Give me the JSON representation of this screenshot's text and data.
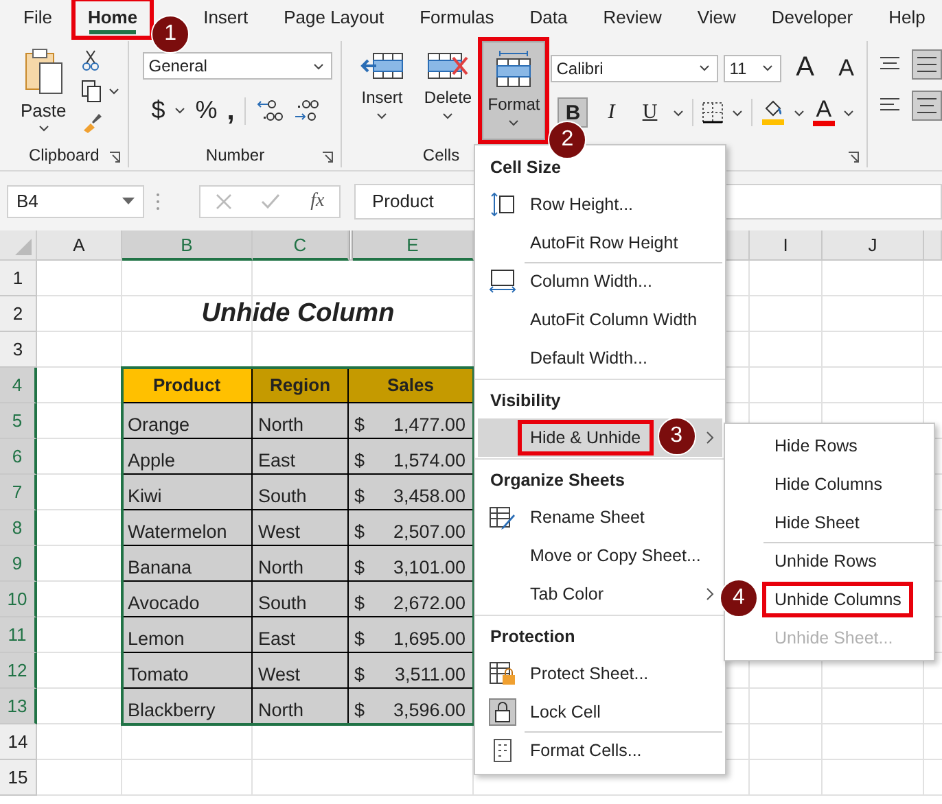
{
  "menu_tabs": [
    {
      "label": "File",
      "selected": false,
      "highlighted": false
    },
    {
      "label": "Home",
      "selected": true,
      "highlighted": true,
      "callout": "1"
    },
    {
      "label": "Insert",
      "selected": false,
      "highlighted": false
    },
    {
      "label": "Page Layout",
      "selected": false,
      "highlighted": false
    },
    {
      "label": "Formulas",
      "selected": false,
      "highlighted": false
    },
    {
      "label": "Data",
      "selected": false,
      "highlighted": false
    },
    {
      "label": "Review",
      "selected": false,
      "highlighted": false
    },
    {
      "label": "View",
      "selected": false,
      "highlighted": false
    },
    {
      "label": "Developer",
      "selected": false,
      "highlighted": false
    },
    {
      "label": "Help",
      "selected": false,
      "highlighted": false
    }
  ],
  "ribbon": {
    "clipboard": {
      "label": "Clipboard",
      "paste": "Paste"
    },
    "number": {
      "label": "Number",
      "format": "General",
      "symbols": [
        "$",
        "%",
        ","
      ]
    },
    "cells": {
      "label": "Cells",
      "buttons": [
        {
          "label": "Insert",
          "kind": "insert",
          "pressed": false,
          "highlighted": false
        },
        {
          "label": "Delete",
          "kind": "delete",
          "pressed": false,
          "highlighted": false
        },
        {
          "label": "Format",
          "kind": "format",
          "pressed": true,
          "highlighted": true,
          "callout": "2"
        }
      ]
    },
    "font": {
      "name": "Calibri",
      "size": "11",
      "grow": "A",
      "shrink": "A",
      "font_color": "A",
      "styles": [
        {
          "label": "B",
          "kind": "bold",
          "pressed": true
        },
        {
          "label": "I",
          "kind": "italic",
          "pressed": false
        },
        {
          "label": "U",
          "kind": "underline",
          "pressed": false
        }
      ]
    }
  },
  "formula_bar": {
    "name_box": "B4",
    "function_label": "fx",
    "value": "Product"
  },
  "sheet": {
    "columns": [
      {
        "label": "A",
        "selected": false
      },
      {
        "label": "B",
        "selected": true
      },
      {
        "label": "C",
        "selected": true
      },
      {
        "label": "E",
        "selected": true
      },
      {
        "label": "I",
        "selected": false
      },
      {
        "label": "J",
        "selected": false
      }
    ],
    "rows": [
      {
        "label": "1",
        "selected": false
      },
      {
        "label": "2",
        "selected": false
      },
      {
        "label": "3",
        "selected": false
      },
      {
        "label": "4",
        "selected": true
      },
      {
        "label": "5",
        "selected": true
      },
      {
        "label": "6",
        "selected": true
      },
      {
        "label": "7",
        "selected": true
      },
      {
        "label": "8",
        "selected": true
      },
      {
        "label": "9",
        "selected": true
      },
      {
        "label": "10",
        "selected": true
      },
      {
        "label": "11",
        "selected": true
      },
      {
        "label": "12",
        "selected": true
      },
      {
        "label": "13",
        "selected": true
      },
      {
        "label": "14",
        "selected": false
      },
      {
        "label": "15",
        "selected": false
      }
    ],
    "title": "Unhide Column",
    "table": {
      "columns": [
        {
          "label": "Product",
          "active": true
        },
        {
          "label": "Region",
          "active": false
        },
        {
          "label": "Sales",
          "active": false
        }
      ],
      "rows": [
        {
          "product": "Orange",
          "region": "North",
          "currency": "$",
          "sales": "1,477.00"
        },
        {
          "product": "Apple",
          "region": "East",
          "currency": "$",
          "sales": "1,574.00"
        },
        {
          "product": "Kiwi",
          "region": "South",
          "currency": "$",
          "sales": "3,458.00"
        },
        {
          "product": "Watermelon",
          "region": "West",
          "currency": "$",
          "sales": "2,507.00"
        },
        {
          "product": "Banana",
          "region": "North",
          "currency": "$",
          "sales": "3,101.00"
        },
        {
          "product": "Avocado",
          "region": "South",
          "currency": "$",
          "sales": "2,672.00"
        },
        {
          "product": "Lemon",
          "region": "East",
          "currency": "$",
          "sales": "1,695.00"
        },
        {
          "product": "Tomato",
          "region": "West",
          "currency": "$",
          "sales": "3,511.00"
        },
        {
          "product": "Blackberry",
          "region": "North",
          "currency": "$",
          "sales": "3,596.00"
        }
      ]
    }
  },
  "format_menu": {
    "sections": [
      {
        "title": "Cell Size",
        "items": [
          {
            "label": "Row Height...",
            "kind": "row-height",
            "separator_before": false,
            "submenu": false,
            "selected": false,
            "highlighted": false
          },
          {
            "label": "AutoFit Row Height",
            "kind": "plain",
            "separator_before": false,
            "submenu": false,
            "selected": false,
            "highlighted": false
          },
          {
            "label": "Column Width...",
            "kind": "column-width",
            "separator_before": true,
            "submenu": false,
            "selected": false,
            "highlighted": false
          },
          {
            "label": "AutoFit Column Width",
            "kind": "plain",
            "separator_before": false,
            "submenu": false,
            "selected": false,
            "highlighted": false
          },
          {
            "label": "Default Width...",
            "kind": "plain",
            "separator_before": false,
            "submenu": false,
            "selected": false,
            "highlighted": false
          }
        ]
      },
      {
        "title": "Visibility",
        "items": [
          {
            "label": "Hide & Unhide",
            "kind": "plain",
            "separator_before": false,
            "submenu": true,
            "selected": true,
            "highlighted": true,
            "callout": "3"
          }
        ]
      },
      {
        "title": "Organize Sheets",
        "items": [
          {
            "label": "Rename Sheet",
            "kind": "rename",
            "separator_before": false,
            "submenu": false,
            "selected": false,
            "highlighted": false
          },
          {
            "label": "Move or Copy Sheet...",
            "kind": "plain",
            "separator_before": false,
            "submenu": false,
            "selected": false,
            "highlighted": false
          },
          {
            "label": "Tab Color",
            "kind": "plain",
            "separator_before": false,
            "submenu": true,
            "selected": false,
            "highlighted": false
          }
        ]
      },
      {
        "title": "Protection",
        "items": [
          {
            "label": "Protect Sheet...",
            "kind": "protect",
            "separator_before": false,
            "submenu": false,
            "selected": false,
            "highlighted": false
          },
          {
            "label": "Lock Cell",
            "kind": "lock",
            "separator_before": false,
            "submenu": false,
            "selected": false,
            "highlighted": false
          },
          {
            "label": "Format Cells...",
            "kind": "format-cells",
            "separator_before": true,
            "submenu": false,
            "selected": false,
            "highlighted": false
          }
        ]
      }
    ]
  },
  "submenu": {
    "items": [
      {
        "label": "Hide Rows",
        "separator_before": false,
        "disabled": false,
        "highlighted": false
      },
      {
        "label": "Hide Columns",
        "separator_before": false,
        "disabled": false,
        "highlighted": false
      },
      {
        "label": "Hide Sheet",
        "separator_before": false,
        "disabled": false,
        "highlighted": false
      },
      {
        "label": "Unhide Rows",
        "separator_before": true,
        "disabled": false,
        "highlighted": false
      },
      {
        "label": "Unhide Columns",
        "separator_before": false,
        "disabled": false,
        "highlighted": true,
        "callout": "4"
      },
      {
        "label": "Unhide Sheet...",
        "separator_before": false,
        "disabled": true,
        "highlighted": false
      }
    ]
  }
}
